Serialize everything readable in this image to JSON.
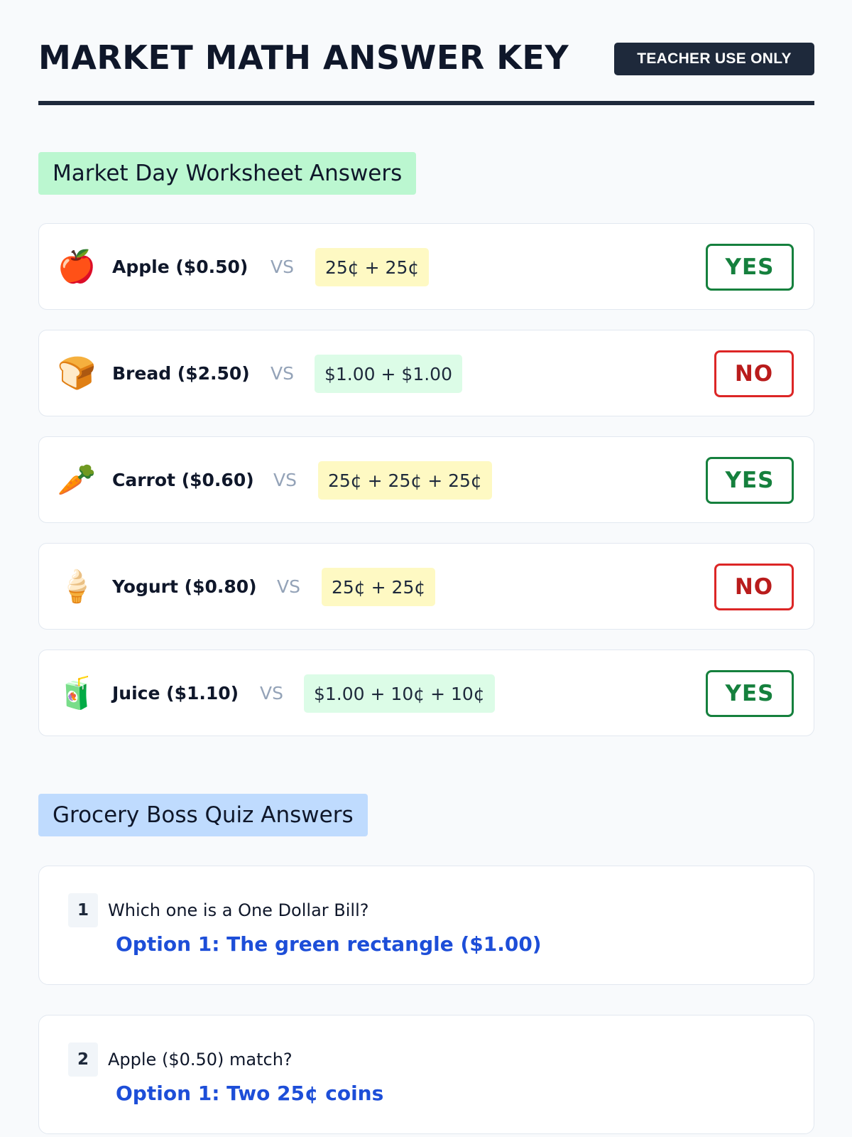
{
  "header": {
    "title": "MARKET MATH ANSWER KEY",
    "badge": "TEACHER USE ONLY"
  },
  "worksheet": {
    "heading": "Market Day Worksheet Answers",
    "vs_label": "VS",
    "rows": [
      {
        "emoji": "🍎",
        "icon": "apple-icon",
        "item": "Apple ($0.50)",
        "coins": "25¢ + 25¢",
        "coins_color": "#fef9c3",
        "verdict": "YES"
      },
      {
        "emoji": "🍞",
        "icon": "bread-icon",
        "item": "Bread ($2.50)",
        "coins": "$1.00 + $1.00",
        "coins_color": "#dcfce7",
        "verdict": "NO"
      },
      {
        "emoji": "🥕",
        "icon": "carrot-icon",
        "item": "Carrot ($0.60)",
        "coins": "25¢ + 25¢ + 25¢",
        "coins_color": "#fef9c3",
        "verdict": "YES"
      },
      {
        "emoji": "🍦",
        "icon": "ice-cream-icon",
        "item": "Yogurt ($0.80)",
        "coins": "25¢ + 25¢",
        "coins_color": "#fef9c3",
        "verdict": "NO"
      },
      {
        "emoji": "🧃",
        "icon": "juice-box-icon",
        "item": "Juice ($1.10)",
        "coins": "$1.00 + 10¢ + 10¢",
        "coins_color": "#dcfce7",
        "verdict": "YES"
      }
    ]
  },
  "quiz": {
    "heading": "Grocery Boss Quiz Answers",
    "items": [
      {
        "number": "1",
        "question": "Which one is a One Dollar Bill?",
        "answer": "Option 1: The green rectangle ($1.00)"
      },
      {
        "number": "2",
        "question": "Apple ($0.50) match?",
        "answer": "Option 1: Two 25¢ coins"
      }
    ]
  },
  "colors": {
    "yes": "#15803d",
    "no": "#b91c1c",
    "answer": "#1d4ed8",
    "worksheet_tag": "#bbf7d0",
    "quiz_tag": "#bfdbfe"
  }
}
